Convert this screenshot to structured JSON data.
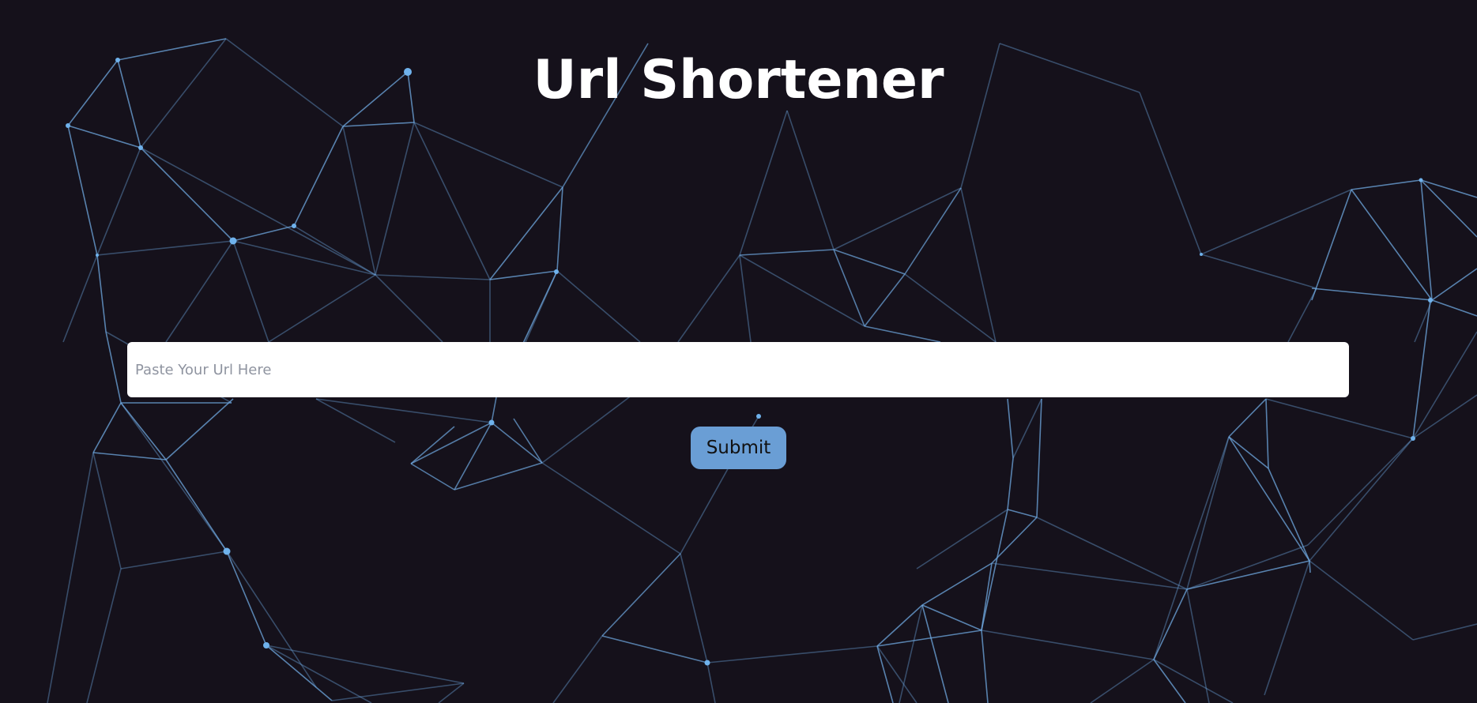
{
  "header": {
    "title": "Url Shortener"
  },
  "form": {
    "url_placeholder": "Paste Your Url Here",
    "url_value": "",
    "submit_label": "Submit"
  },
  "colors": {
    "background": "#15111b",
    "network_line": "#6fa8e0",
    "button": "#6a9ed5",
    "title": "#ffffff"
  }
}
